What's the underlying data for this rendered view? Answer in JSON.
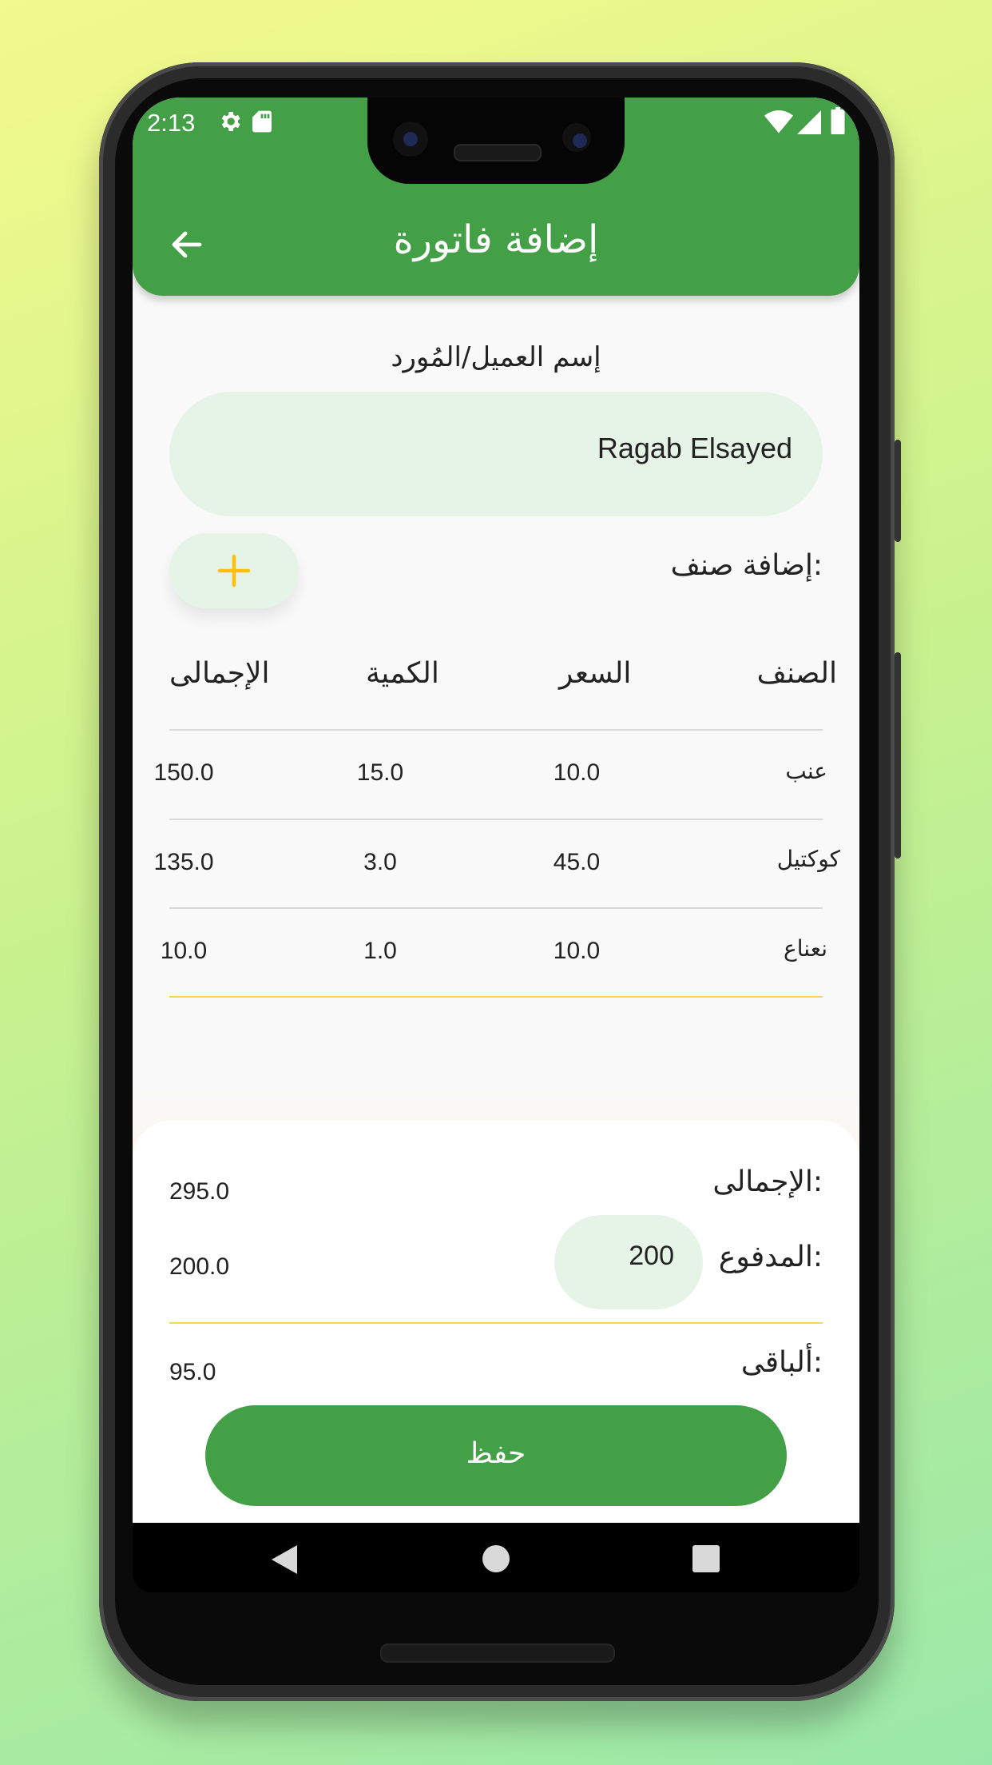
{
  "status_bar": {
    "time": "2:13"
  },
  "app_bar": {
    "title": "إضافة فاتورة"
  },
  "customer": {
    "label": "إسم العميل/المُورد",
    "value": "Ragab Elsayed"
  },
  "add_item": {
    "label": "إضافة صنف:",
    "button": "+"
  },
  "table": {
    "headers": {
      "item": "الصنف",
      "price": "السعر",
      "quantity": "الكمية",
      "total": "الإجمالى"
    },
    "rows": [
      {
        "item": "عنب",
        "price": "10.0",
        "quantity": "15.0",
        "total": "150.0"
      },
      {
        "item": "كوكتيل",
        "price": "45.0",
        "quantity": "3.0",
        "total": "135.0"
      },
      {
        "item": "نعناع",
        "price": "10.0",
        "quantity": "1.0",
        "total": "10.0"
      }
    ]
  },
  "summary": {
    "total_label": "الإجمالى:",
    "total_value": "295.0",
    "paid_label": "المدفوع:",
    "paid_input": "200",
    "paid_value": "200.0",
    "remaining_label": "ألباقى:",
    "remaining_value": "95.0"
  },
  "save_button": "حفظ",
  "colors": {
    "primary": "#43a047",
    "field": "#e6f4e7",
    "accent": "#ffc107"
  }
}
